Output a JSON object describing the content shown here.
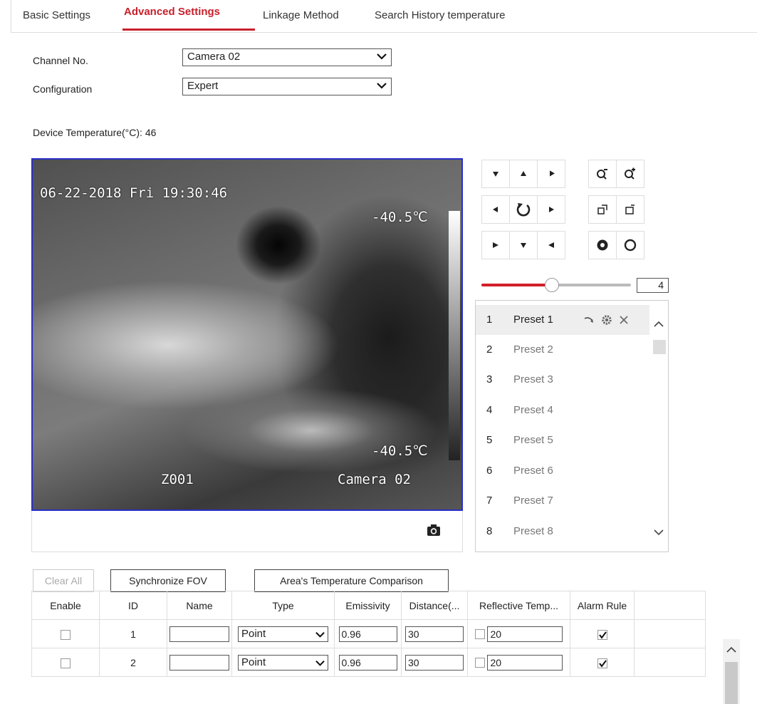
{
  "tabs": [
    {
      "label": "Basic Settings"
    },
    {
      "label": "Advanced Settings",
      "active": true
    },
    {
      "label": "Linkage Method"
    },
    {
      "label": "Search History temperature"
    }
  ],
  "form": {
    "channel_label": "Channel No.",
    "channel_value": "Camera 02",
    "config_label": "Configuration",
    "config_value": "Expert"
  },
  "device_temp": "Device Temperature(°C): 46",
  "video": {
    "timestamp": "06-22-2018 Fri 19:30:46",
    "temp_top": "-40.5℃",
    "temp_bottom": "-40.5℃",
    "zone": "Z001",
    "camera_label": "Camera 02"
  },
  "ptz": {
    "speed": "4",
    "speed_level_fraction": 0.47
  },
  "presets": [
    {
      "num": "1",
      "name": "Preset 1"
    },
    {
      "num": "2",
      "name": "Preset 2"
    },
    {
      "num": "3",
      "name": "Preset 3"
    },
    {
      "num": "4",
      "name": "Preset 4"
    },
    {
      "num": "5",
      "name": "Preset 5"
    },
    {
      "num": "6",
      "name": "Preset 6"
    },
    {
      "num": "7",
      "name": "Preset 7"
    },
    {
      "num": "8",
      "name": "Preset 8"
    }
  ],
  "buttons": {
    "clear_all": "Clear All",
    "sync_fov": "Synchronize FOV",
    "area_compare": "Area's Temperature Comparison"
  },
  "table": {
    "headers": [
      "Enable",
      "ID",
      "Name",
      "Type",
      "Emissivity",
      "Distance(...",
      "Reflective Temp...",
      "Alarm Rule"
    ],
    "rows": [
      {
        "id": "1",
        "name": "",
        "type": "Point",
        "emissivity": "0.96",
        "distance": "30",
        "reflective": "20",
        "alarm": true
      },
      {
        "id": "2",
        "name": "",
        "type": "Point",
        "emissivity": "0.96",
        "distance": "30",
        "reflective": "20",
        "alarm": true
      }
    ]
  },
  "colors": {
    "accent": "#c8202b",
    "video_border": "#2a2fc7"
  }
}
